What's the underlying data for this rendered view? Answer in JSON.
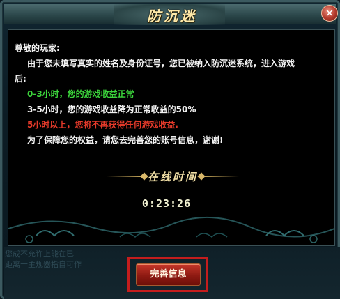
{
  "dialog": {
    "title": "防沉迷",
    "close_symbol": "✕",
    "close_icon": "close-icon"
  },
  "message": {
    "greeting": "尊敬的玩家:",
    "line1": "由于您未填写真实的姓名及身份证号，您已被纳入防沉迷系统，进入游戏",
    "line2": "后:",
    "tier1": "0-3小时，您的游戏收益正常",
    "tier2": "3-5小时，您的游戏收益降为正常收益的50%",
    "tier3": "5小时以上，您将不再获得任何游戏收益.",
    "closing": "为了保障您的权益，请您去完善您的账号信息，谢谢!"
  },
  "online": {
    "label": "在线时间",
    "time": "0:23:26"
  },
  "background_text": {
    "line1": "您成不允许上能在已",
    "line2": "距离十主规器指自可作"
  },
  "actions": {
    "complete_info_label": "完善信息"
  },
  "colors": {
    "normal_tier": "#3cd53c",
    "reduced_tier": "#f2f2f2",
    "no_reward_tier": "#e53a2a",
    "highlight_frame": "#c41d1d"
  }
}
